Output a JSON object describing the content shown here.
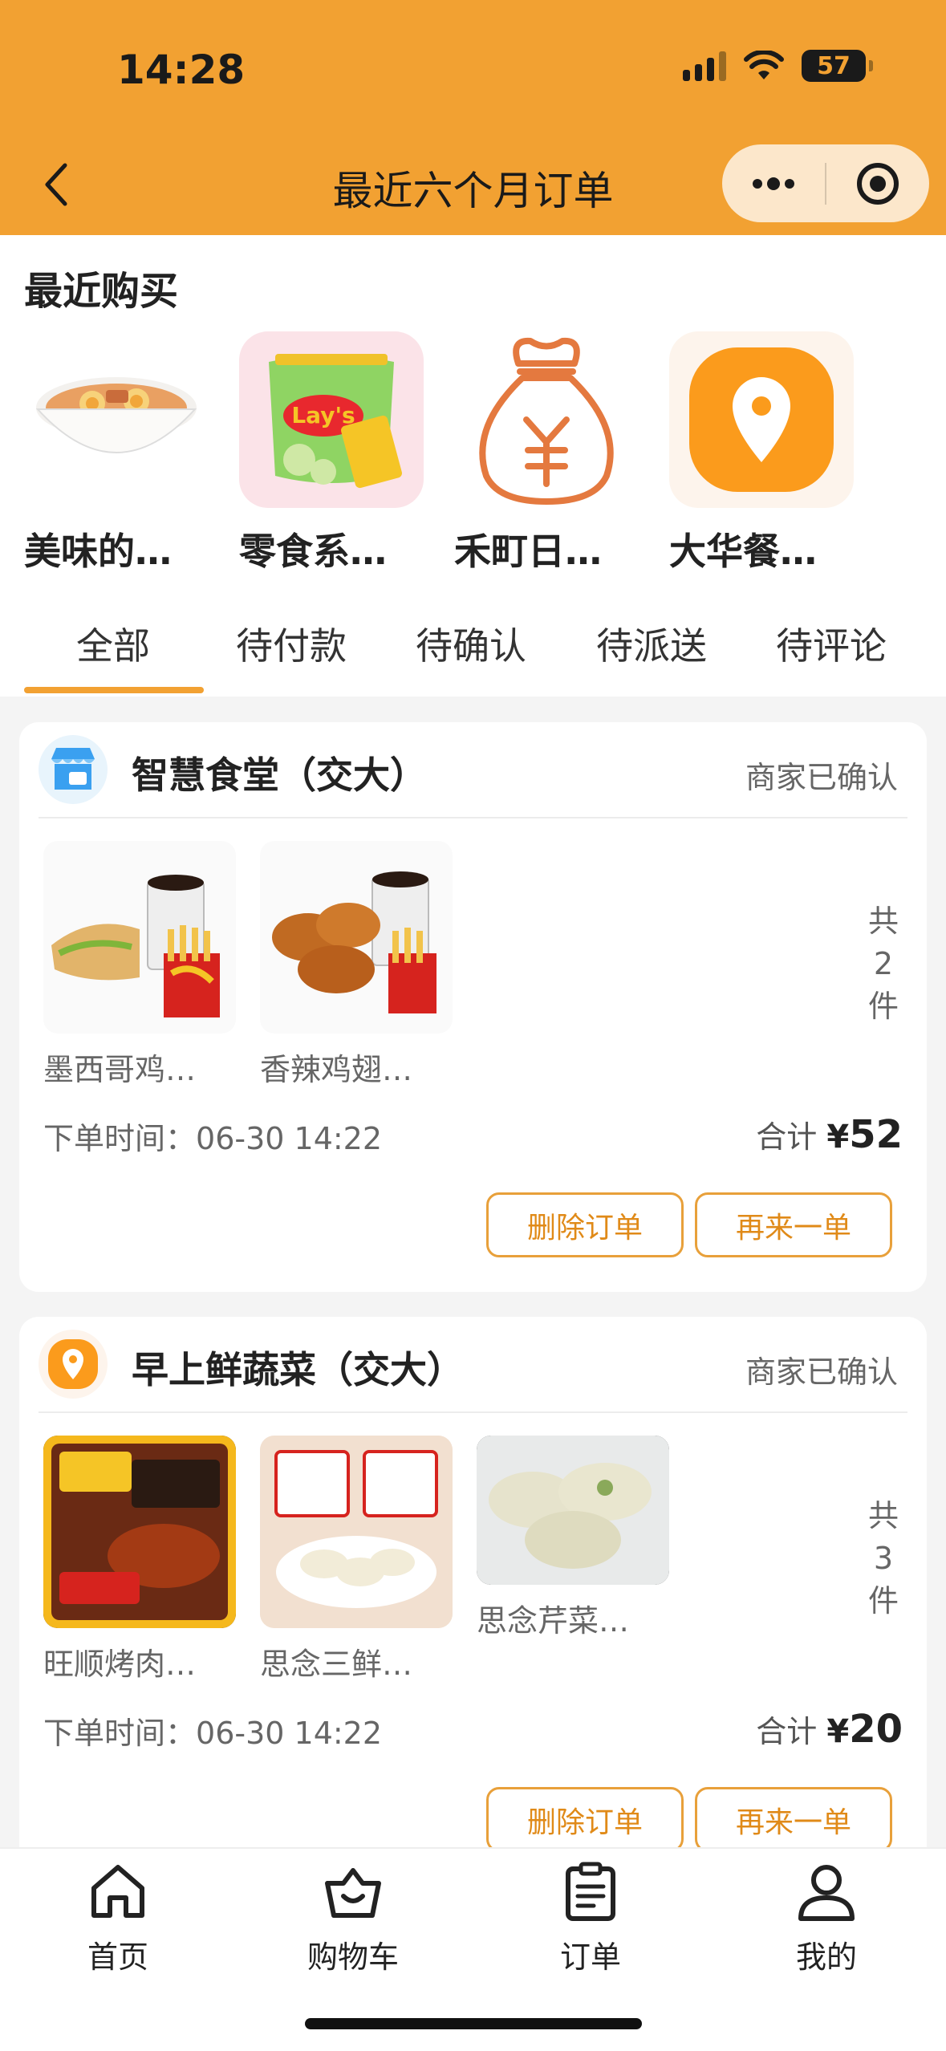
{
  "status_bar": {
    "time": "14:28",
    "battery": "57"
  },
  "nav": {
    "title": "最近六个月订单"
  },
  "recent": {
    "title": "最近购买",
    "items": [
      {
        "name": "美味的…",
        "icon": "noodle-bowl"
      },
      {
        "name": "零食系…",
        "icon": "chips-bag"
      },
      {
        "name": "禾町日…",
        "icon": "money-bag"
      },
      {
        "name": "大华餐…",
        "icon": "location-pin"
      }
    ]
  },
  "tabs": [
    "全部",
    "待付款",
    "待确认",
    "待派送",
    "待评论"
  ],
  "orders": [
    {
      "shop": "智慧食堂（交大）",
      "status": "商家已确认",
      "products": [
        "墨西哥鸡…",
        "香辣鸡翅…"
      ],
      "count_label": [
        "共",
        "2",
        "件"
      ],
      "time_label": "下单时间：",
      "time": "06-30 14:22",
      "total_label": "合计",
      "currency": "¥",
      "total": "52",
      "buttons": {
        "delete": "删除订单",
        "reorder": "再来一单"
      }
    },
    {
      "shop": "早上鲜蔬菜（交大）",
      "status": "商家已确认",
      "products": [
        "旺顺烤肉…",
        "思念三鲜…",
        "思念芹菜…"
      ],
      "count_label": [
        "共",
        "3",
        "件"
      ],
      "time_label": "下单时间：",
      "time": "06-30 14:22",
      "total_label": "合计",
      "currency": "¥",
      "total": "20",
      "buttons": {
        "delete": "删除订单",
        "reorder": "再来一单"
      }
    }
  ],
  "tabbar": [
    {
      "label": "首页",
      "icon": "home-icon"
    },
    {
      "label": "购物车",
      "icon": "basket-icon"
    },
    {
      "label": "订单",
      "icon": "clipboard-icon"
    },
    {
      "label": "我的",
      "icon": "user-icon"
    }
  ],
  "colors": {
    "accent": "#f2a132",
    "button_border": "#e8a03a",
    "bg": "#f4f4f4"
  }
}
